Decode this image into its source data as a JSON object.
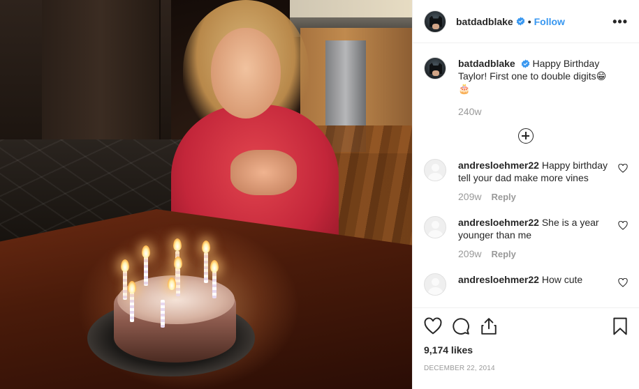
{
  "post": {
    "author": {
      "username": "batdadblake",
      "follow_label": "Follow",
      "separator": "•",
      "more_label": "•••"
    },
    "caption": {
      "username": "batdadblake",
      "text": "Happy Birthday Taylor! First one to double digits😁🎂",
      "age": "240w"
    },
    "load_more_icon": "plus-circle-icon",
    "comments": [
      {
        "username": "andresloehmer22",
        "text": "Happy birthday tell your dad make more vines",
        "age": "209w",
        "reply_label": "Reply"
      },
      {
        "username": "andresloehmer22",
        "text": "She is a year younger than me",
        "age": "209w",
        "reply_label": "Reply"
      },
      {
        "username": "andresloehmer22",
        "text": "How cute",
        "age": "",
        "reply_label": ""
      }
    ],
    "likes": "9,174 likes",
    "date": "December 22, 2014",
    "icons": [
      "heart-icon",
      "comment-icon",
      "share-icon",
      "bookmark-icon",
      "verified-badge-icon",
      "more-options-icon"
    ],
    "colors": {
      "accent": "#3897f0",
      "text": "#262626",
      "muted": "#999999",
      "border": "#efefef"
    }
  }
}
